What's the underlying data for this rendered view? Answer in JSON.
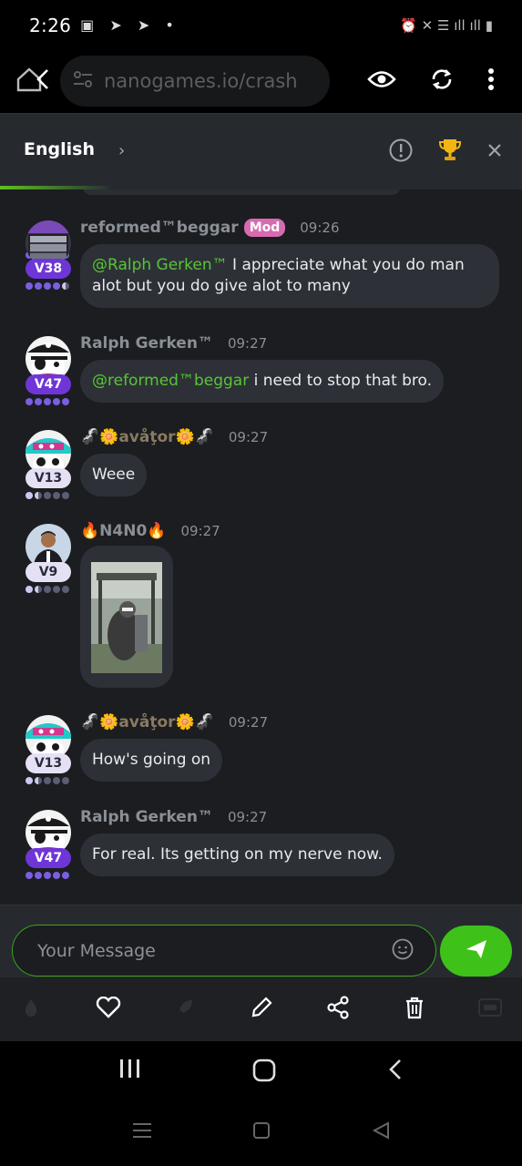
{
  "status_bar": {
    "time": "2:26",
    "left_icons": "▣ ➤ ➤ •",
    "right_icons": "⏰ ✕ ☰ ıll ıll ▮"
  },
  "browser": {
    "url": "nanogames.io/crash"
  },
  "chat_header": {
    "language": "English"
  },
  "messages": [
    {
      "username": "reformed™beggar",
      "badge": "Mod",
      "time": "09:26",
      "level": "V38",
      "mention": "@Ralph Gerken™",
      "text": " I appreciate what you do man alot but you do give alot to many"
    },
    {
      "username": "Ralph Gerken™",
      "time": "09:27",
      "level": "V47",
      "mention": "@reformed™beggar",
      "text": " i need to stop that bro."
    },
    {
      "username": "🦨🌼avåţor🌼🦨",
      "time": "09:27",
      "level": "V13",
      "text": "Weee"
    },
    {
      "username": "🔥N4N0🔥",
      "time": "09:27",
      "level": "V9"
    },
    {
      "username": "🦨🌼avåţor🌼🦨",
      "time": "09:27",
      "level": "V13",
      "text": "How's going on"
    },
    {
      "username": "Ralph Gerken™",
      "time": "09:27",
      "level": "V47",
      "text": "For real. Its getting on my nerve now."
    }
  ],
  "composer": {
    "placeholder": "Your Message"
  },
  "colors": {
    "accent": "#3ec21a",
    "mention": "#59c436",
    "mod": "#d66bb1",
    "level_purple": "#6e36d6"
  }
}
